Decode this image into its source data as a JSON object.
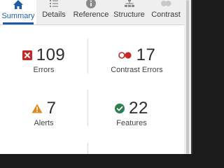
{
  "tabs": [
    {
      "label": "Summary",
      "icon": "home-icon",
      "active": true
    },
    {
      "label": "Details",
      "icon": "list-icon",
      "active": false
    },
    {
      "label": "Reference",
      "icon": "info-icon",
      "active": false
    },
    {
      "label": "Structure",
      "icon": "structure-icon",
      "active": false
    },
    {
      "label": "Contrast",
      "icon": "contrast-icon",
      "active": false
    }
  ],
  "summary": {
    "errors": {
      "count": "109",
      "label": "Errors",
      "icon": "error-icon",
      "color": "#c62828"
    },
    "contrast_errors": {
      "count": "17",
      "label": "Contrast Errors",
      "icon": "contrast-error-icon",
      "color": "#c62828"
    },
    "alerts": {
      "count": "7",
      "label": "Alerts",
      "icon": "alert-icon",
      "color": "#e08a1e"
    },
    "features": {
      "count": "22",
      "label": "Features",
      "icon": "feature-icon",
      "color": "#2e7d4f"
    }
  },
  "colors": {
    "accent": "#1e5aa5",
    "tab_bar": "#efefef"
  }
}
